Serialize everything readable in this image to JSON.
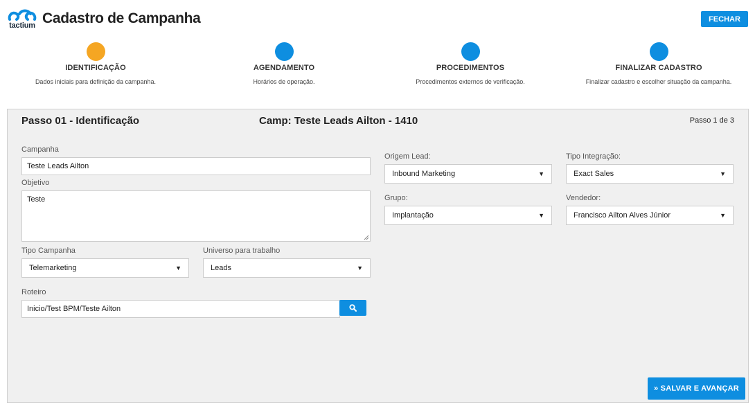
{
  "header": {
    "logo_text": "tactium",
    "title": "Cadastro de Campanha",
    "close_label": "FECHAR"
  },
  "steps": [
    {
      "title": "IDENTIFICAÇÃO",
      "desc": "Dados iniciais para definição da campanha.",
      "color": "#f5a623",
      "active": true
    },
    {
      "title": "AGENDAMENTO",
      "desc": "Horários de operação.",
      "color": "#0e8ee0",
      "active": false
    },
    {
      "title": "PROCEDIMENTOS",
      "desc": "Procedimentos externos de verificação.",
      "color": "#0e8ee0",
      "active": false
    },
    {
      "title": "FINALIZAR CADASTRO",
      "desc": "Finalizar cadastro e escolher situação da campanha.",
      "color": "#0e8ee0",
      "active": false
    }
  ],
  "panel": {
    "title": "Passo 01 - Identificação",
    "camp": "Camp: Teste Leads Ailton - 1410",
    "step_counter": "Passo 1 de 3"
  },
  "form": {
    "campanha": {
      "label": "Campanha",
      "value": "Teste Leads Ailton"
    },
    "objetivo": {
      "label": "Objetivo",
      "value": "Teste"
    },
    "tipo_campanha": {
      "label": "Tipo Campanha",
      "value": "Telemarketing"
    },
    "universo": {
      "label": "Universo para trabalho",
      "value": "Leads"
    },
    "roteiro": {
      "label": "Roteiro",
      "value": "Inicio/Test BPM/Teste Ailton"
    },
    "origem_lead": {
      "label": "Origem Lead:",
      "value": "Inbound Marketing"
    },
    "tipo_integracao": {
      "label": "Tipo Integração:",
      "value": "Exact Sales"
    },
    "grupo": {
      "label": "Grupo:",
      "value": "Implantação"
    },
    "vendedor": {
      "label": "Vendedor:",
      "value": "Francisco Ailton Alves Júnior"
    },
    "save_label": "» SALVAR E AVANÇAR"
  },
  "colors": {
    "accent": "#0e8ee0",
    "active_step": "#f5a623",
    "panel_bg": "#f0f0f0"
  },
  "icons": {
    "logo": "tactium-logo-icon",
    "search": "search-icon",
    "caret": "caret-down-icon",
    "resize": "resize-grip-icon"
  }
}
